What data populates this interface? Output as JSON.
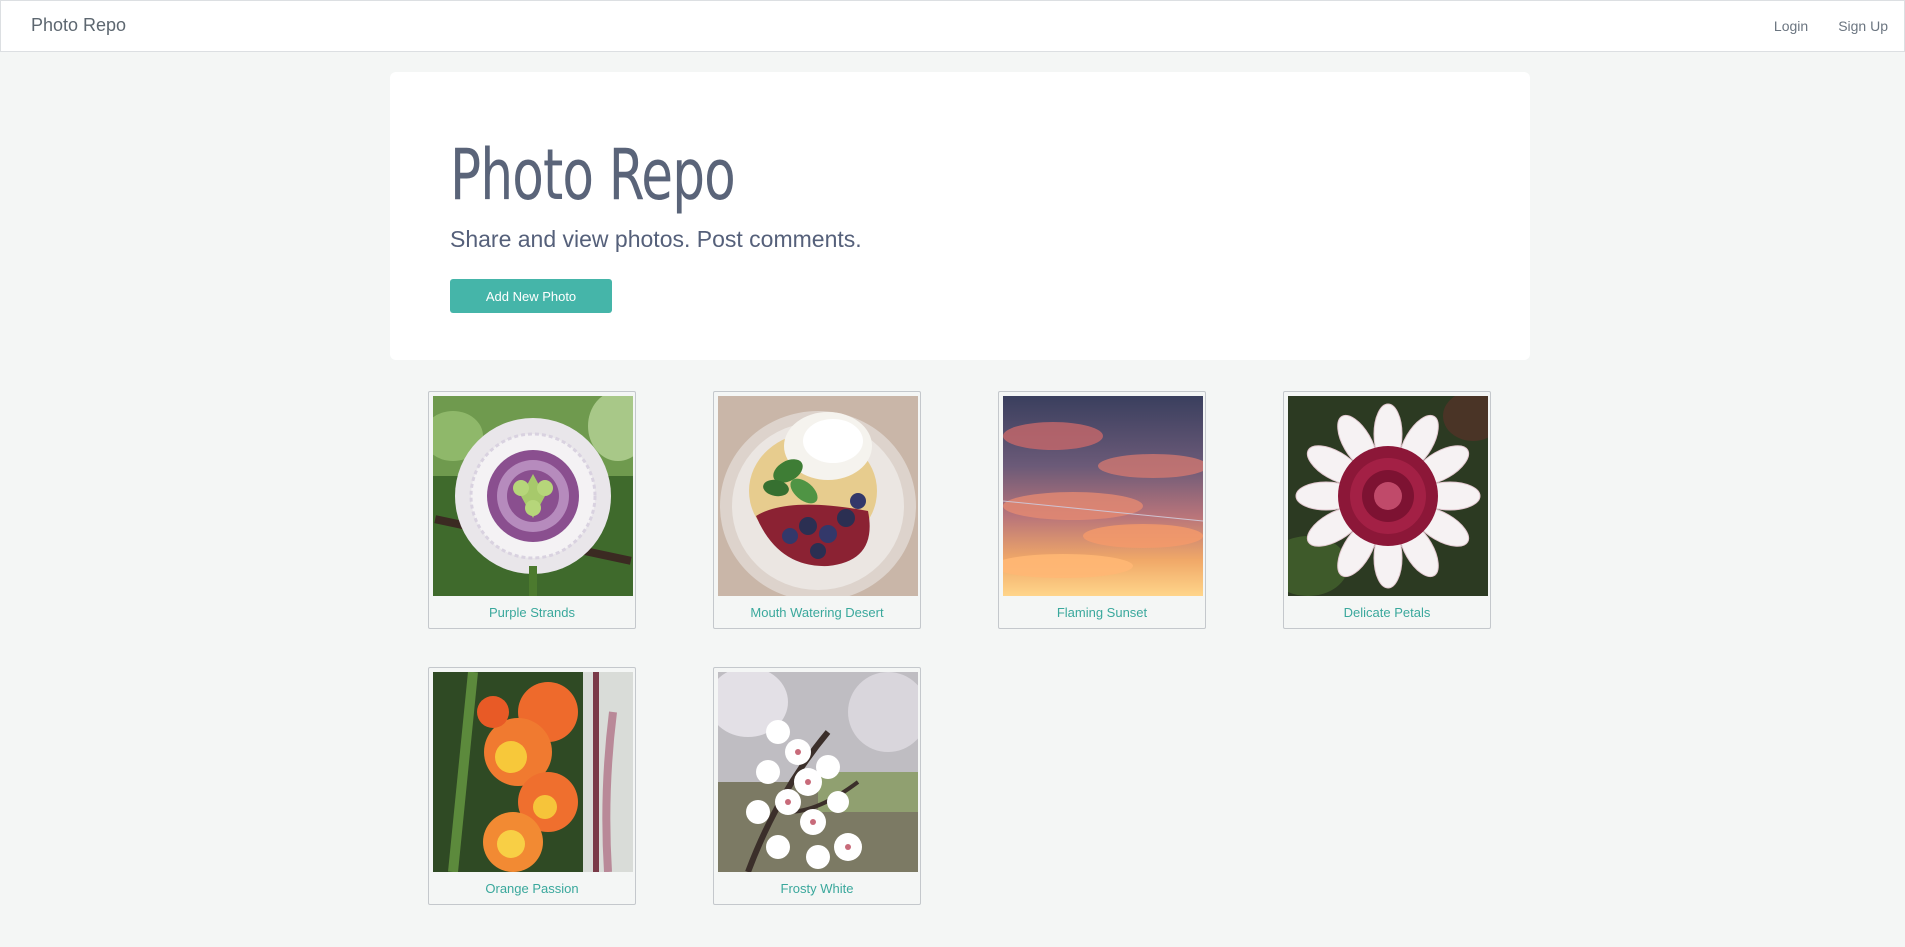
{
  "navbar": {
    "brand": "Photo Repo",
    "links": {
      "login": "Login",
      "signup": "Sign Up"
    }
  },
  "jumbotron": {
    "title": "Photo Repo",
    "lead": "Share and view photos. Post comments.",
    "add_button": "Add New Photo"
  },
  "colors": {
    "accent": "#45b5a9",
    "link": "#3aa89c",
    "background": "#f4f6f5"
  },
  "photos": [
    {
      "title": "Purple Strands",
      "image": "passion-flower-photo"
    },
    {
      "title": "Mouth Watering Desert",
      "image": "berry-dessert-photo"
    },
    {
      "title": "Flaming Sunset",
      "image": "sunset-sky-photo"
    },
    {
      "title": "Delicate Petals",
      "image": "dahlia-flower-photo"
    },
    {
      "title": "Orange Passion",
      "image": "gladiolus-flower-photo"
    },
    {
      "title": "Frosty White",
      "image": "almond-blossom-photo"
    }
  ]
}
